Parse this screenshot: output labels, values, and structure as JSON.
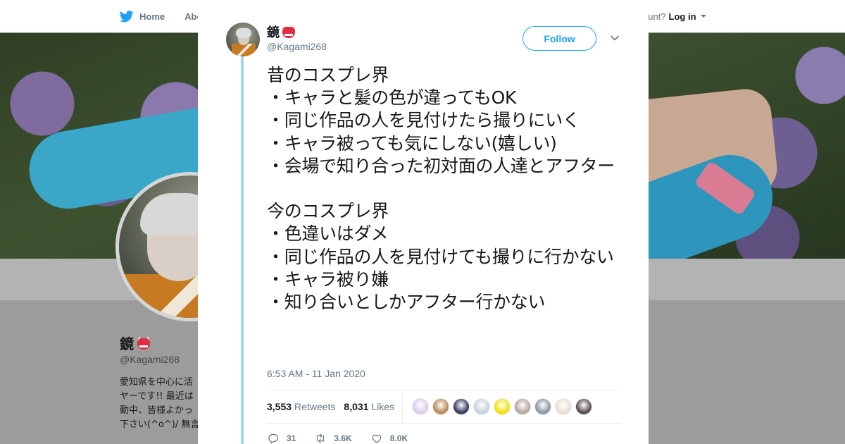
{
  "background": {
    "nav": {
      "home_label": "Home",
      "about_label": "Abo",
      "account_text": "ccount?",
      "login_label": "Log in"
    },
    "profile": {
      "name": "鏡",
      "handle": "@Kagami268",
      "bio_lines": [
        "愛知県を中心に活",
        "ヤーです!! 最近は",
        "動中、皆様よかっ",
        "下さい(^o^)/ 無言"
      ]
    }
  },
  "modal": {
    "author": {
      "name": "鏡",
      "name_emoji": "ogre-icon",
      "handle": "@Kagami268"
    },
    "follow_label": "Follow",
    "tweet_text": "昔のコスプレ界\n・キャラと髪の色が違ってもOK\n・同じ作品の人を見付けたら撮りにいく\n・キャラ被っても気にしない(嬉しい)\n・会場で知り合った初対面の人達とアフター\n\n今のコスプレ界\n・色違いはダメ\n・同じ作品の人を見付けても撮りに行かない\n・キャラ被り嫌\n・知り合いとしかアフター行かない",
    "timestamp": "6:53 AM - 11 Jan 2020",
    "stats": {
      "retweets_count": "3,553",
      "retweets_label": "Retweets",
      "likes_count": "8,031",
      "likes_label": "Likes"
    },
    "liker_colors": [
      "#d9cdeb",
      "#b88d5c",
      "#3b3f5e",
      "#c9d3de",
      "#f2e30d",
      "#b9a8a0",
      "#8f9aa8",
      "#e9e0d3",
      "#5c5050"
    ],
    "actions": {
      "replies": "31",
      "retweets": "3.6K",
      "likes": "8.0K"
    }
  },
  "colors": {
    "accent": "#1da1f2",
    "thread_line": "#a7d1f3",
    "text_primary": "#14171a",
    "text_secondary": "#657786",
    "dimmed_background": "#9c9c9c"
  }
}
